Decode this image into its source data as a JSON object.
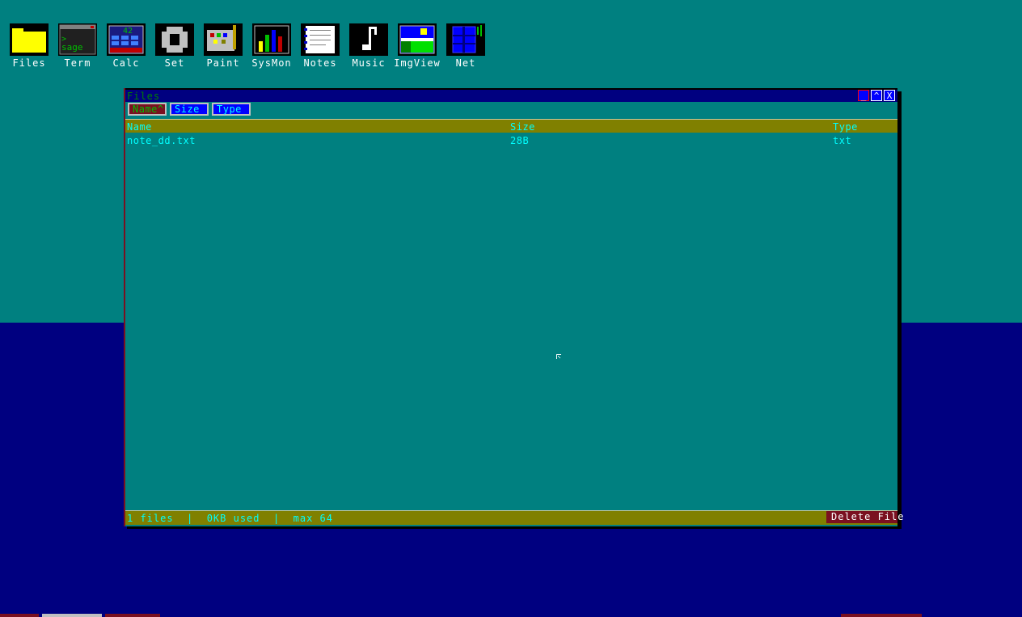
{
  "desktop": {
    "icons": [
      {
        "label": "Files",
        "icon": "folder-icon"
      },
      {
        "label": "Term",
        "icon": "terminal-icon",
        "glyph": "sage"
      },
      {
        "label": "Calc",
        "icon": "calculator-icon",
        "glyph": "42"
      },
      {
        "label": "Set",
        "icon": "gear-icon"
      },
      {
        "label": "Paint",
        "icon": "palette-icon"
      },
      {
        "label": "SysMon",
        "icon": "bar-chart-icon"
      },
      {
        "label": "Notes",
        "icon": "notepad-icon"
      },
      {
        "label": "Music",
        "icon": "music-note-icon"
      },
      {
        "label": "ImgView",
        "icon": "image-icon"
      },
      {
        "label": "Net",
        "icon": "network-icon"
      }
    ]
  },
  "window": {
    "title": "Files",
    "buttons": {
      "minimize": "_",
      "maximize": "^",
      "close": "X"
    },
    "sort": {
      "name": "Name^",
      "size": "Size",
      "type": "Type"
    },
    "columns": {
      "name": "Name",
      "size": "Size",
      "type": "Type"
    },
    "files": [
      {
        "name": "note_dd.txt",
        "size": "28B",
        "type": "txt"
      }
    ],
    "status": "1 files  |  0KB used  |  max 64",
    "delete_label": "Delete File"
  },
  "colors": {
    "desktop_teal": "#008080",
    "desktop_navy": "#000080",
    "header_olive": "#808000",
    "text_cyan": "#00ffff",
    "accent_maroon": "#7a1020"
  }
}
